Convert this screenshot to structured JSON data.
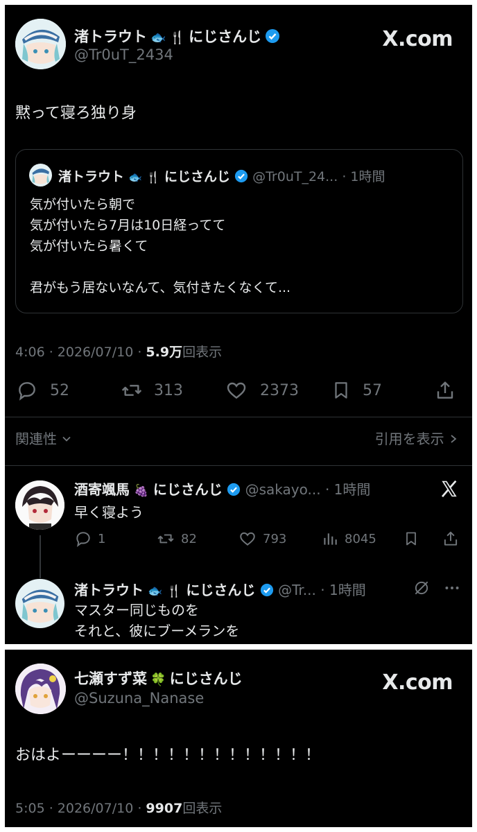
{
  "tweet": {
    "author_name": "渚トラウト",
    "author_suffix": "にじさんじ",
    "author_handle": "@Tr0uT_2434",
    "brand": "X.com",
    "text": "黙って寝ろ独り身",
    "quote": {
      "author_name": "渚トラウト",
      "author_suffix": "にじさんじ",
      "author_handle": "@Tr0uT_24...",
      "time": "· 1時間",
      "lines": [
        "気が付いたら朝で",
        "気が付いたら7月は10日経ってて",
        "気が付いたら暑くて",
        "",
        "君がもう居ないなんて、気付きたくなくて..."
      ]
    },
    "timestamp": "4:06 · 2026/07/10 ·",
    "views_count": "5.9万",
    "views_label": "回表示",
    "actions": {
      "replies": "52",
      "retweets": "313",
      "likes": "2373",
      "bookmarks": "57"
    },
    "relevance_label": "関連性",
    "show_quotes_label": "引用を表示"
  },
  "reply1": {
    "author_name": "酒寄颯馬",
    "author_suffix": "にじさんじ",
    "author_handle": "@sakayo...",
    "time": "· 1時間",
    "text": "早く寝よう",
    "actions": {
      "replies": "1",
      "retweets": "82",
      "likes": "793",
      "views": "8045"
    }
  },
  "reply2": {
    "author_name": "渚トラウト",
    "author_suffix": "にじさんじ",
    "author_handle": "@Tr...",
    "time": "· 1時間",
    "lines": [
      "マスター同じものを",
      "それと、彼にブーメランを"
    ]
  },
  "tweet2": {
    "author_name": "七瀬すず菜",
    "author_suffix": "にじさんじ",
    "author_handle": "@Suzuna_Nanase",
    "brand": "X.com",
    "text": "おはよーーーー！！！！！！！！！！！！！",
    "timestamp": "5:05 · 2026/07/10 ·",
    "views_count": "9907",
    "views_label": "回表示"
  },
  "colors": {
    "background": "#000000",
    "text": "#e7e9ea",
    "muted": "#71767b",
    "verified": "#1d9bf0",
    "border": "#2f3336"
  }
}
